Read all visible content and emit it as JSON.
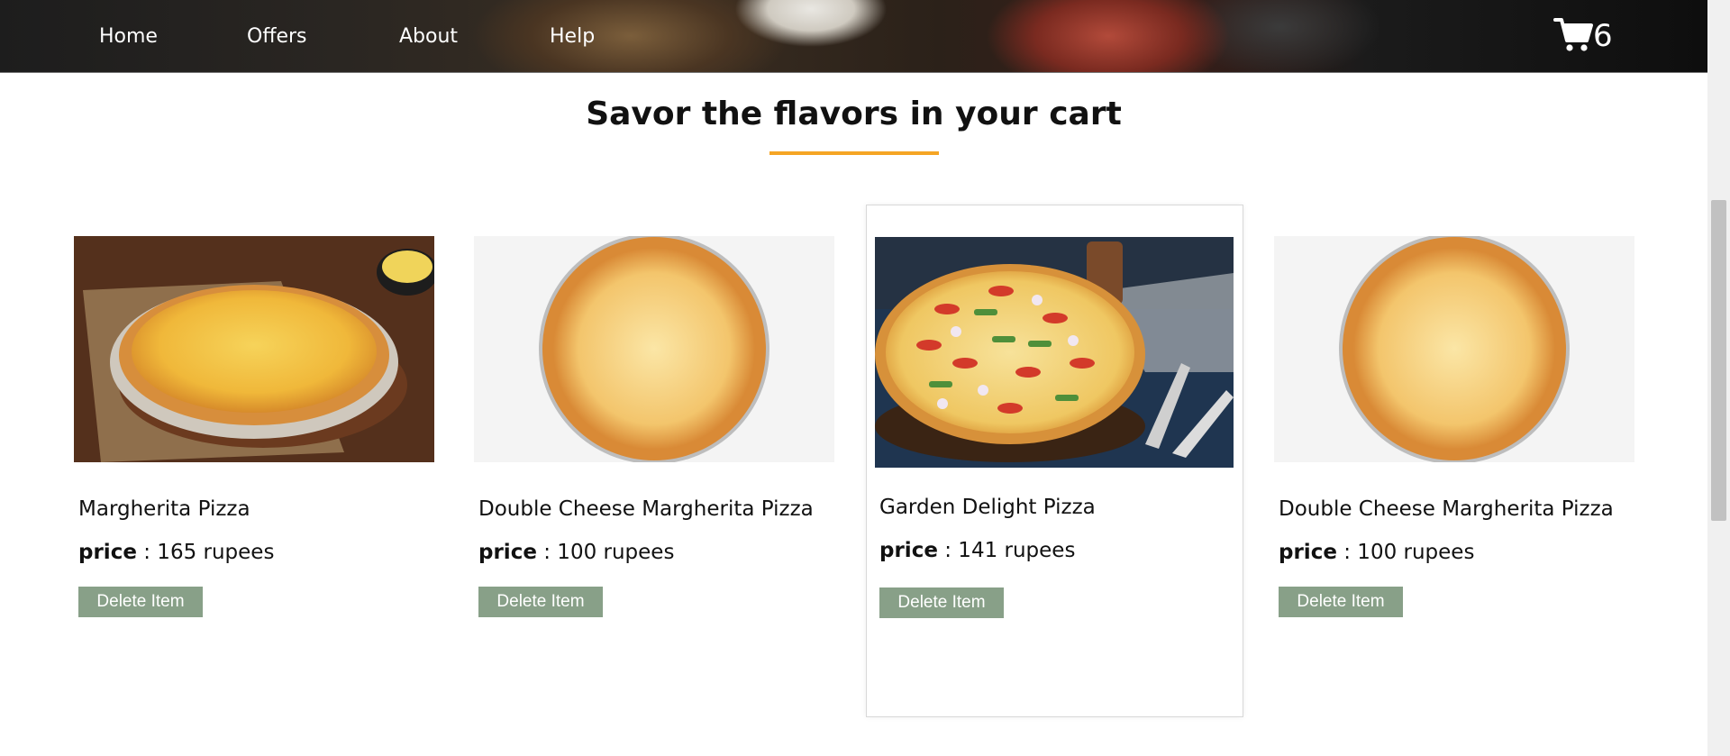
{
  "nav": {
    "links": [
      {
        "label": "Home"
      },
      {
        "label": "Offers"
      },
      {
        "label": "About"
      },
      {
        "label": "Help"
      }
    ],
    "cart_count": "6"
  },
  "page": {
    "title": "Savor the flavors in your cart"
  },
  "cart_items": [
    {
      "name": "Margherita Pizza",
      "price_label": "price",
      "price_value": ": 165 rupees",
      "delete_label": "Delete Item"
    },
    {
      "name": "Double Cheese Margherita Pizza",
      "price_label": "price",
      "price_value": ": 100 rupees",
      "delete_label": "Delete Item"
    },
    {
      "name": "Garden Delight Pizza",
      "price_label": "price",
      "price_value": ": 141 rupees",
      "delete_label": "Delete Item"
    },
    {
      "name": "Double Cheese Margherita Pizza",
      "price_label": "price",
      "price_value": ": 100 rupees",
      "delete_label": "Delete Item"
    }
  ],
  "colors": {
    "accent_underline": "#f5a524",
    "delete_button": "#88a088"
  }
}
